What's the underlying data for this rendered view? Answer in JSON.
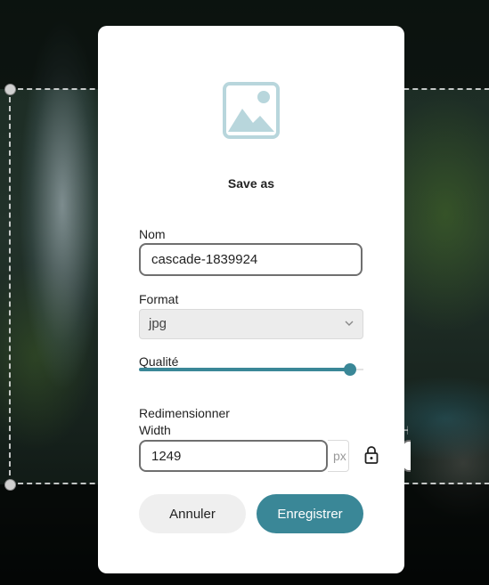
{
  "dialog": {
    "title": "Save as",
    "hero_icon": "image-icon",
    "name": {
      "label": "Nom",
      "value": "cascade-1839924"
    },
    "format": {
      "label": "Format",
      "selected": "jpg",
      "icon": "chevron-down-icon"
    },
    "quality": {
      "label": "Qualité",
      "level": 0.94
    },
    "resize": {
      "label": "Redimensionner",
      "width_label": "Width",
      "width_value": "1249",
      "unit": "px",
      "lock_icon": "lock-icon"
    },
    "buttons": {
      "cancel": "Annuler",
      "save": "Enregistrer"
    }
  },
  "colors": {
    "accent": "#3a8797",
    "icon_tint": "#b8d6dc"
  }
}
